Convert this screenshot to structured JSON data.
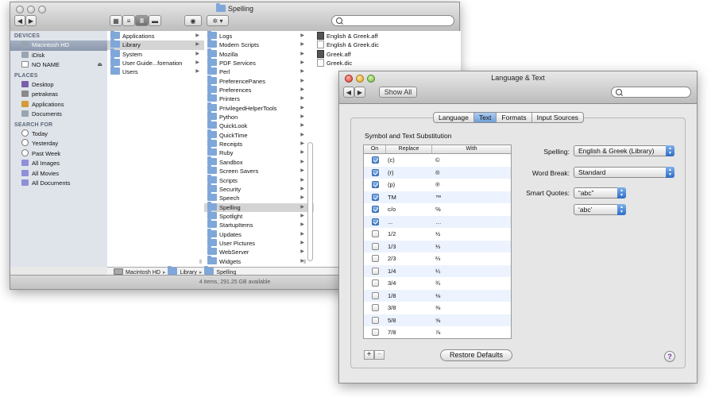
{
  "finder": {
    "title": "Spelling",
    "sidebar": {
      "devices_header": "DEVICES",
      "devices": [
        "Macintosh HD",
        "iDisk",
        "NO NAME"
      ],
      "places_header": "PLACES",
      "places": [
        "Desktop",
        "petrakeas",
        "Applications",
        "Documents"
      ],
      "search_header": "SEARCH FOR",
      "searches": [
        "Today",
        "Yesterday",
        "Past Week",
        "All Images",
        "All Movies",
        "All Documents"
      ]
    },
    "col1": [
      "Applications",
      "Library",
      "System",
      "User Guide...formation",
      "Users"
    ],
    "col2": [
      "Logs",
      "Modem Scripts",
      "Mozilla",
      "PDF Services",
      "Perl",
      "PreferencePanes",
      "Preferences",
      "Printers",
      "PrivilegedHelperTools",
      "Python",
      "QuickLook",
      "QuickTime",
      "Receipts",
      "Ruby",
      "Sandbox",
      "Screen Savers",
      "Scripts",
      "Security",
      "Speech",
      "Spelling",
      "Spotlight",
      "StartupItems",
      "Updates",
      "User Pictures",
      "WebServer",
      "Widgets"
    ],
    "col3": [
      "English & Greek.aff",
      "English & Greek.dic",
      "Greek.aff",
      "Greek.dic"
    ],
    "path": [
      "Macintosh HD",
      "Library",
      "Spelling"
    ],
    "status": "4 items, 291.25 GB available"
  },
  "prefs": {
    "title": "Language & Text",
    "show_all": "Show All",
    "tabs": [
      "Language",
      "Text",
      "Formats",
      "Input Sources"
    ],
    "group_title": "Symbol and Text Substitution",
    "columns": [
      "On",
      "Replace",
      "With"
    ],
    "rows": [
      {
        "on": true,
        "replace": "(c)",
        "with": "©"
      },
      {
        "on": true,
        "replace": "(r)",
        "with": "®"
      },
      {
        "on": true,
        "replace": "(p)",
        "with": "℗"
      },
      {
        "on": true,
        "replace": "TM",
        "with": "™"
      },
      {
        "on": true,
        "replace": "c/o",
        "with": "℅"
      },
      {
        "on": true,
        "replace": "...",
        "with": "…"
      },
      {
        "on": false,
        "replace": "1/2",
        "with": "½"
      },
      {
        "on": false,
        "replace": "1/3",
        "with": "⅓"
      },
      {
        "on": false,
        "replace": "2/3",
        "with": "⅔"
      },
      {
        "on": false,
        "replace": "1/4",
        "with": "¼"
      },
      {
        "on": false,
        "replace": "3/4",
        "with": "¾"
      },
      {
        "on": false,
        "replace": "1/8",
        "with": "⅛"
      },
      {
        "on": false,
        "replace": "3/8",
        "with": "⅜"
      },
      {
        "on": false,
        "replace": "5/8",
        "with": "⅝"
      },
      {
        "on": false,
        "replace": "7/8",
        "with": "⅞"
      }
    ],
    "add_label": "+",
    "remove_label": "−",
    "restore_defaults": "Restore Defaults",
    "spelling_label": "Spelling:",
    "spelling_value": "English & Greek (Library)",
    "word_break_label": "Word Break:",
    "word_break_value": "Standard",
    "smart_quotes_label": "Smart Quotes:",
    "double_quotes_value": "“abc”",
    "single_quotes_value": "‘abc’",
    "help_label": "?"
  }
}
